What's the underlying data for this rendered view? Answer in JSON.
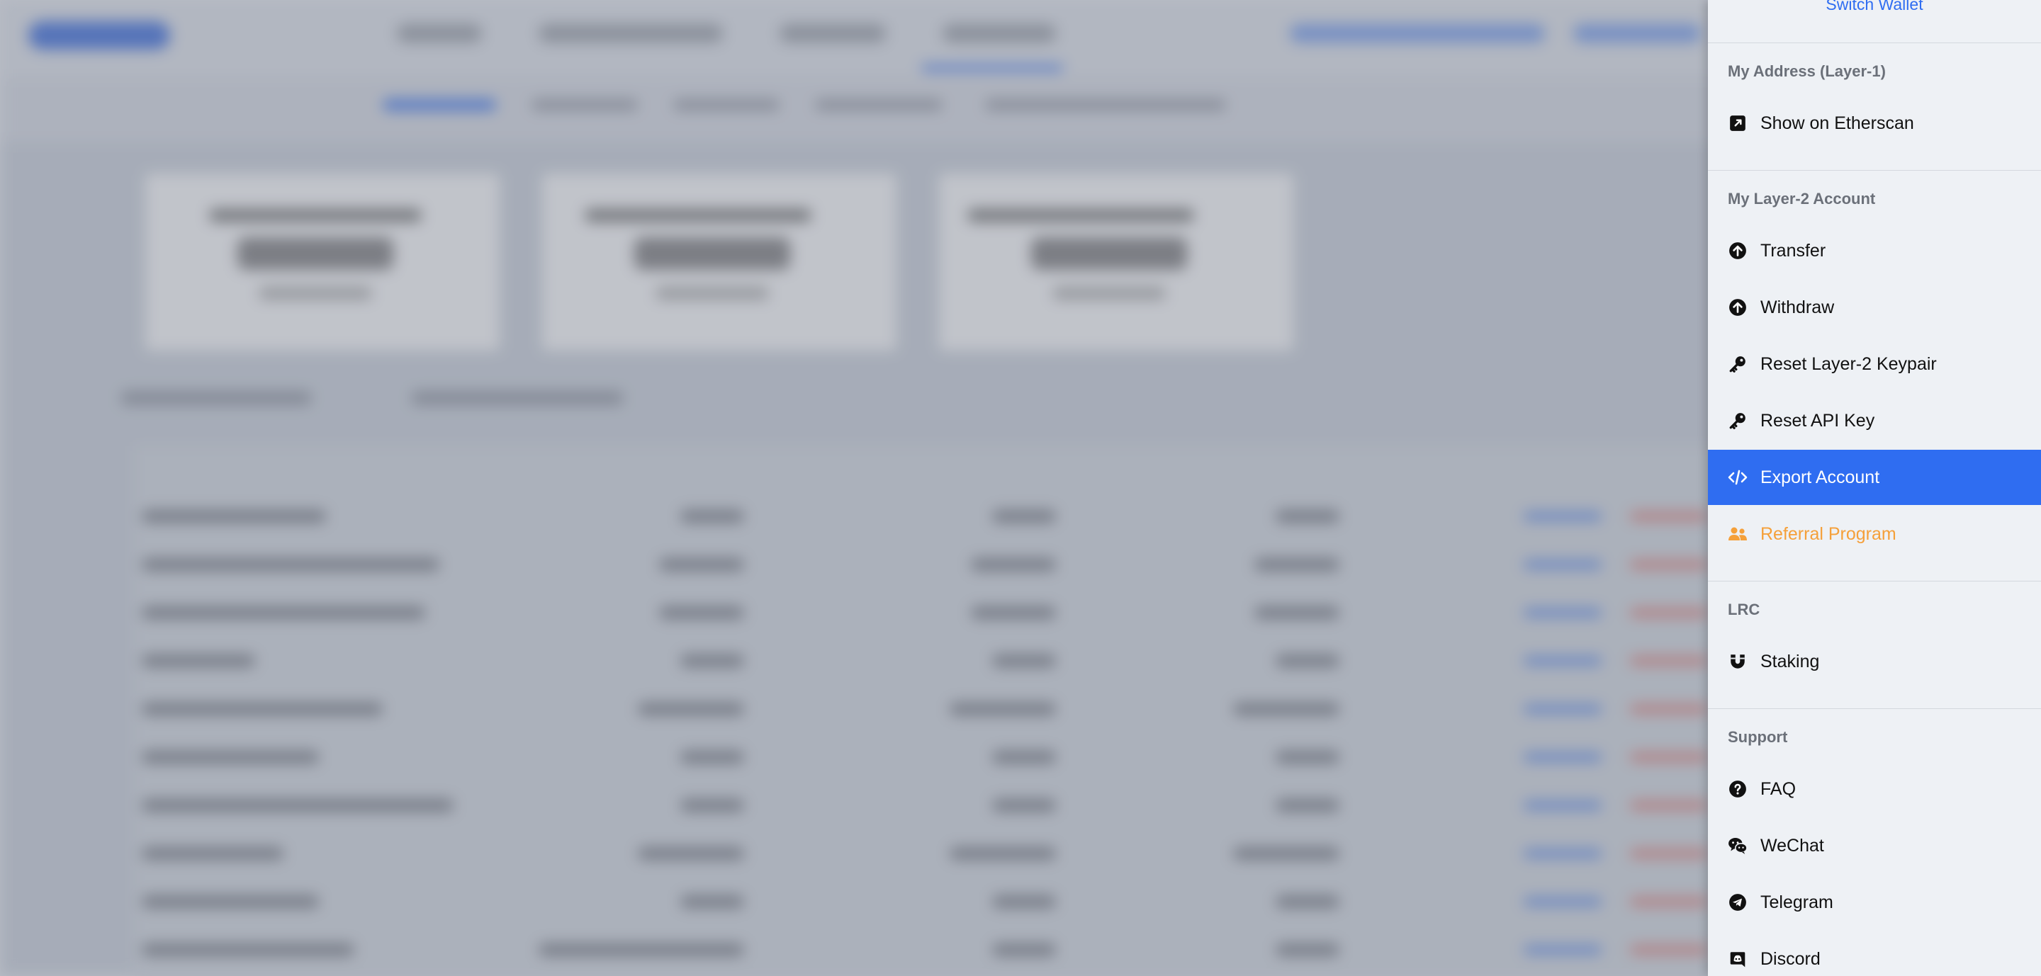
{
  "sidebar": {
    "switch_wallet": "Switch Wallet",
    "sections": {
      "layer1": {
        "title": "My Address (Layer-1)",
        "items": [
          {
            "label": "Show on Etherscan",
            "icon": "external-link-icon"
          }
        ]
      },
      "layer2": {
        "title": "My Layer-2 Account",
        "items": [
          {
            "label": "Transfer",
            "icon": "arrow-up-circle-icon"
          },
          {
            "label": "Withdraw",
            "icon": "arrow-up-circle-icon"
          },
          {
            "label": "Reset Layer-2 Keypair",
            "icon": "key-icon"
          },
          {
            "label": "Reset API Key",
            "icon": "key-icon"
          },
          {
            "label": "Export Account",
            "icon": "code-icon",
            "state": "active"
          },
          {
            "label": "Referral Program",
            "icon": "users-icon",
            "state": "highlight"
          }
        ]
      },
      "lrc": {
        "title": "LRC",
        "items": [
          {
            "label": "Staking",
            "icon": "magnet-icon"
          }
        ]
      },
      "support": {
        "title": "Support",
        "items": [
          {
            "label": "FAQ",
            "icon": "question-circle-icon"
          },
          {
            "label": "WeChat",
            "icon": "wechat-icon"
          },
          {
            "label": "Telegram",
            "icon": "telegram-icon"
          },
          {
            "label": "Discord",
            "icon": "discord-icon"
          }
        ]
      }
    }
  },
  "colors": {
    "accent": "#2f6df1",
    "highlight": "#f5a03a",
    "sidebar_bg": "#eef1f5",
    "section_title": "#6b7079"
  }
}
